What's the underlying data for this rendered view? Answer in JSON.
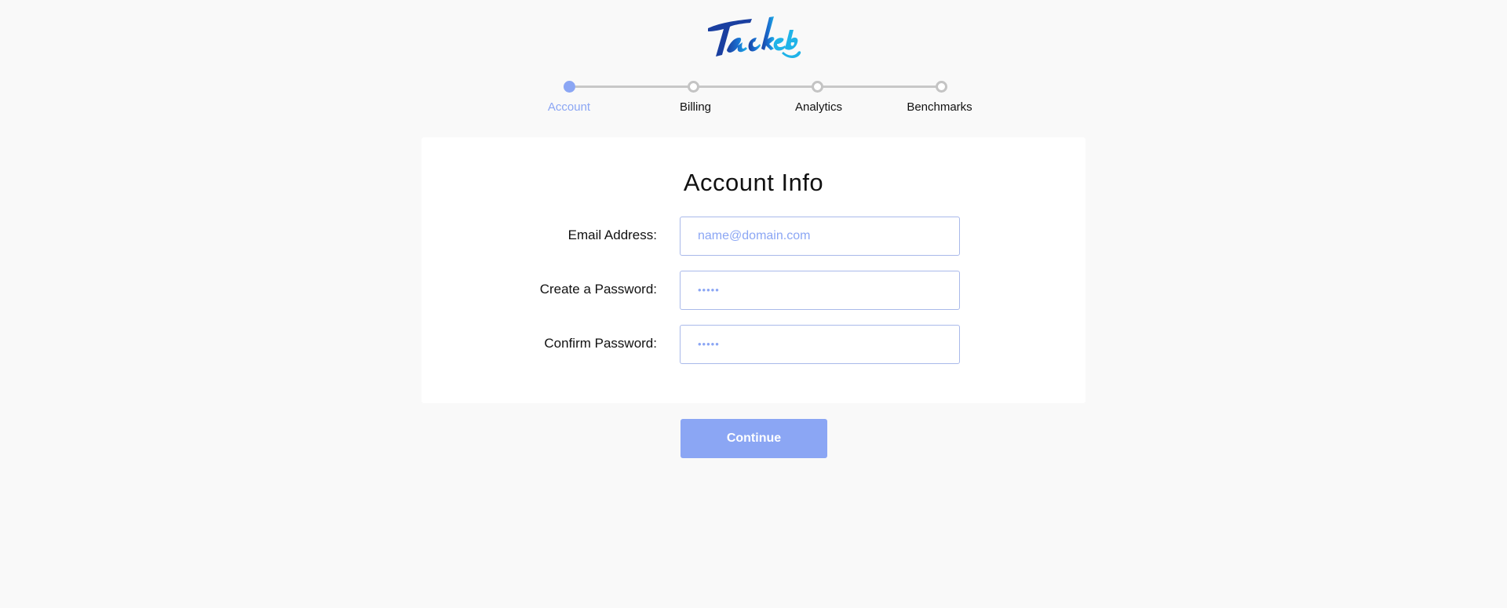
{
  "brand": {
    "logo_icon": "tacklebox-logo-icon",
    "colors": {
      "logo_dark": "#1a3fa0",
      "logo_light": "#1fb3e8"
    }
  },
  "stepper": {
    "steps": [
      {
        "label": "Account",
        "active": true
      },
      {
        "label": "Billing",
        "active": false
      },
      {
        "label": "Analytics",
        "active": false
      },
      {
        "label": "Benchmarks",
        "active": false
      }
    ],
    "colors": {
      "active": "#8ba6f4",
      "inactive": "#c4c4c4"
    }
  },
  "form": {
    "title": "Account Info",
    "email": {
      "label": "Email Address:",
      "value": "",
      "placeholder": "name@domain.com"
    },
    "password": {
      "label": "Create a Password:",
      "value": "",
      "placeholder": "•••••"
    },
    "confirm": {
      "label": "Confirm Password:",
      "value": "",
      "placeholder": "•••••"
    }
  },
  "actions": {
    "continue_label": "Continue",
    "accent_color": "#8ba6f4"
  }
}
